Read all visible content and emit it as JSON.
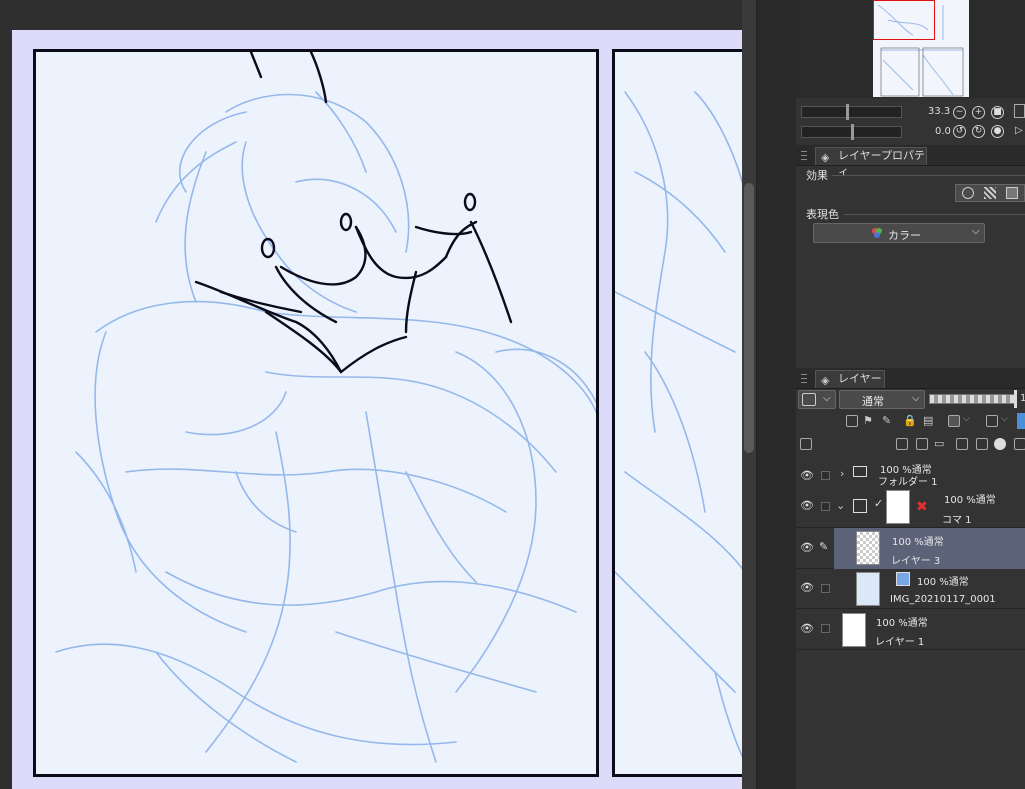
{
  "navigator": {
    "zoom_value": "33.3",
    "rotate_value": "0.0"
  },
  "layer_property": {
    "tab_label": "レイヤープロパティ",
    "effect_label": "効果",
    "expression_color_label": "表現色",
    "expression_color_value": "カラー"
  },
  "layers_panel": {
    "tab_label": "レイヤー",
    "blend_mode": "通常",
    "layers": [
      {
        "opacity_mode": "100 %通常",
        "name": "フォルダー 1"
      },
      {
        "opacity_mode": "100 %通常",
        "name": "コマ 1"
      },
      {
        "opacity_mode": "100 %通常",
        "name": "レイヤー 3"
      },
      {
        "opacity_mode": "100 %通常",
        "name": "IMG_20210117_0001"
      },
      {
        "opacity_mode": "100 %通常",
        "name": "レイヤー 1"
      }
    ]
  },
  "colors": {
    "selected_layer": "#5c6378",
    "sketch_blue": "#7aa6e6",
    "ink_black": "#0b0b1a"
  }
}
